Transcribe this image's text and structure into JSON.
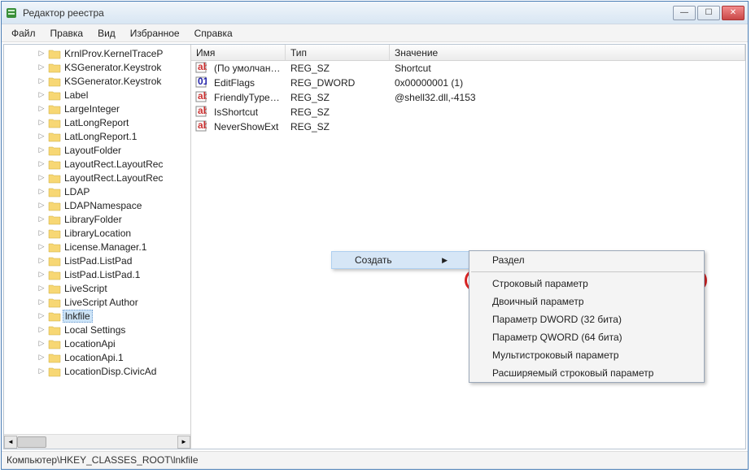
{
  "window": {
    "title": "Редактор реестра"
  },
  "winbtn": {
    "min": "—",
    "max": "☐",
    "close": "✕"
  },
  "menu": {
    "file": "Файл",
    "edit": "Правка",
    "view": "Вид",
    "favorites": "Избранное",
    "help": "Справка"
  },
  "tree": {
    "items": [
      {
        "label": "KrnlProv.KernelTraceP"
      },
      {
        "label": "KSGenerator.Keystrok"
      },
      {
        "label": "KSGenerator.Keystrok"
      },
      {
        "label": "Label"
      },
      {
        "label": "LargeInteger"
      },
      {
        "label": "LatLongReport"
      },
      {
        "label": "LatLongReport.1"
      },
      {
        "label": "LayoutFolder"
      },
      {
        "label": "LayoutRect.LayoutRec"
      },
      {
        "label": "LayoutRect.LayoutRec"
      },
      {
        "label": "LDAP"
      },
      {
        "label": "LDAPNamespace"
      },
      {
        "label": "LibraryFolder"
      },
      {
        "label": "LibraryLocation"
      },
      {
        "label": "License.Manager.1"
      },
      {
        "label": "ListPad.ListPad"
      },
      {
        "label": "ListPad.ListPad.1"
      },
      {
        "label": "LiveScript"
      },
      {
        "label": "LiveScript Author"
      },
      {
        "label": "lnkfile",
        "selected": true
      },
      {
        "label": "Local Settings"
      },
      {
        "label": "LocationApi"
      },
      {
        "label": "LocationApi.1"
      },
      {
        "label": "LocationDisp.CivicAd"
      }
    ]
  },
  "list": {
    "header": {
      "name": "Имя",
      "type": "Тип",
      "data": "Значение"
    },
    "rows": [
      {
        "icon": "sz",
        "name": "(По умолчанию)",
        "type": "REG_SZ",
        "data": "Shortcut"
      },
      {
        "icon": "bin",
        "name": "EditFlags",
        "type": "REG_DWORD",
        "data": "0x00000001 (1)"
      },
      {
        "icon": "sz",
        "name": "FriendlyTypeNa...",
        "type": "REG_SZ",
        "data": "@shell32.dll,-4153"
      },
      {
        "icon": "sz",
        "name": "IsShortcut",
        "type": "REG_SZ",
        "data": ""
      },
      {
        "icon": "sz",
        "name": "NeverShowExt",
        "type": "REG_SZ",
        "data": ""
      }
    ]
  },
  "context": {
    "create": "Создать",
    "sub": {
      "key": "Раздел",
      "string": "Строковый параметр",
      "binary": "Двоичный параметр",
      "dword": "Параметр DWORD (32 бита)",
      "qword": "Параметр QWORD (64 бита)",
      "multi": "Мультистроковый параметр",
      "expand": "Расширяемый строковый параметр"
    }
  },
  "status": {
    "path": "Компьютер\\HKEY_CLASSES_ROOT\\lnkfile"
  }
}
